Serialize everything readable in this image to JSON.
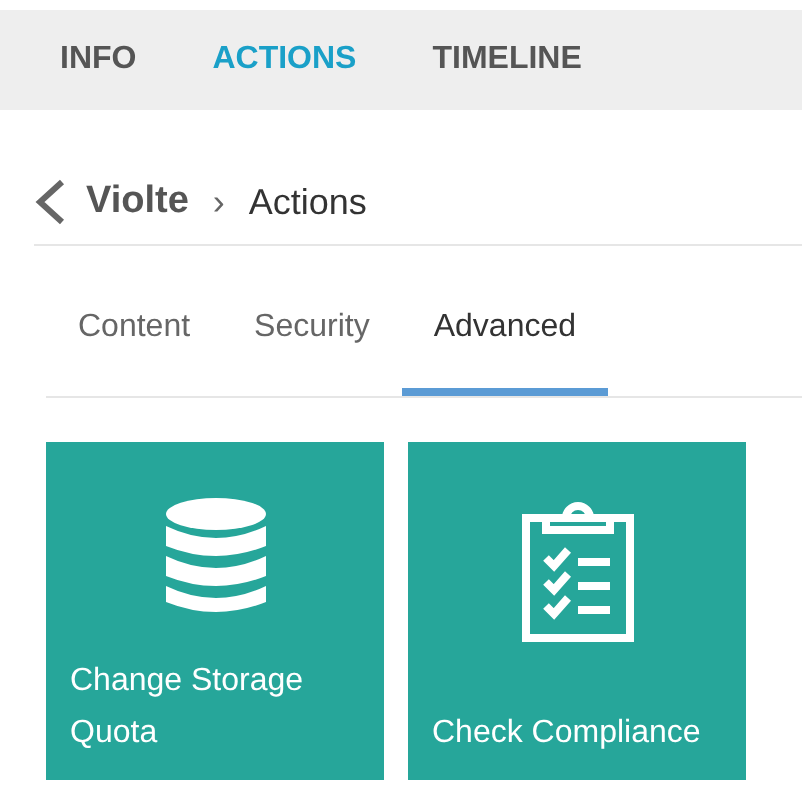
{
  "top_tabs": [
    {
      "label": "INFO",
      "selected": false
    },
    {
      "label": "ACTIONS",
      "selected": true
    },
    {
      "label": "TIMELINE",
      "selected": false
    }
  ],
  "breadcrumb": {
    "back_icon": true,
    "parent": "Violte",
    "separator": "›",
    "current": "Actions"
  },
  "sub_tabs": [
    {
      "label": "Content",
      "selected": false
    },
    {
      "label": "Security",
      "selected": false
    },
    {
      "label": "Advanced",
      "selected": true
    }
  ],
  "tiles": [
    {
      "kind": "database",
      "label": "Change Storage Quota"
    },
    {
      "kind": "clipboard",
      "label": "Check Compliance"
    }
  ]
}
